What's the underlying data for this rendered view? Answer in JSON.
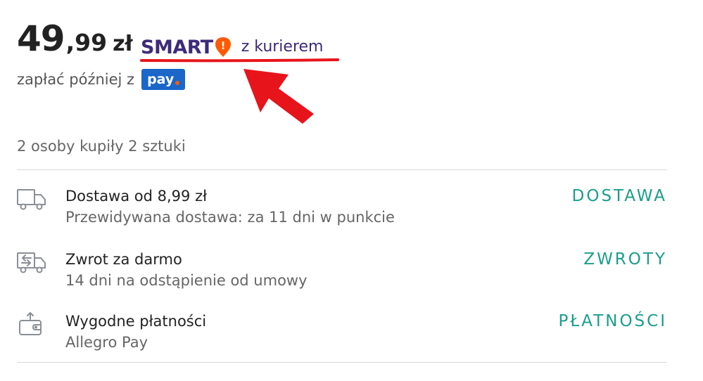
{
  "price": {
    "integer": "49",
    "decimal": ",99",
    "currency": "zł"
  },
  "smart": {
    "logo_text": "SMART",
    "badge_glyph": "!",
    "courier": "z kurierem",
    "logo_color": "#3d2a79",
    "badge_color": "#ff5a00"
  },
  "pay_later": {
    "text": "zapłać później z",
    "badge_text": "pay",
    "badge_color": "#1a66c9"
  },
  "annotation": {
    "color": "#e8141b"
  },
  "popularity": "2 osoby kupiły 2 sztuki",
  "features": [
    {
      "icon": "truck-icon",
      "title": "Dostawa od 8,99 zł",
      "subtitle": "Przewidywana dostawa: za 11 dni w punkcie",
      "link": "DOSTAWA"
    },
    {
      "icon": "truck-return-icon",
      "title": "Zwrot za darmo",
      "subtitle": "14 dni na odstąpienie od umowy",
      "link": "ZWROTY"
    },
    {
      "icon": "wallet-icon",
      "title": "Wygodne płatności",
      "subtitle": "Allegro Pay",
      "link": "PŁATNOŚCI"
    }
  ],
  "accent_color": "#1a9e8a"
}
